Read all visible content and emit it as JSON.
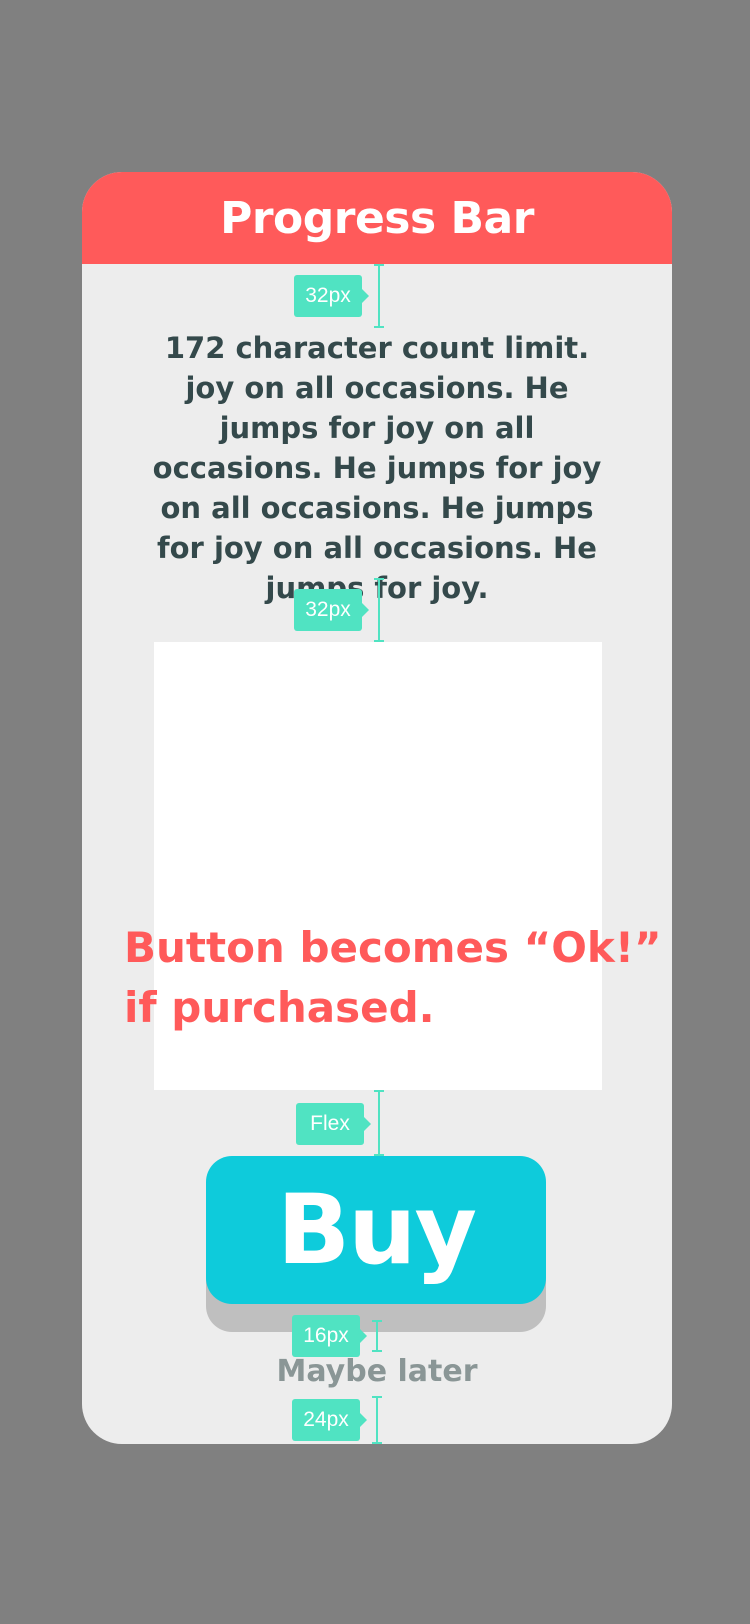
{
  "header": {
    "title": "Progress Bar"
  },
  "content": {
    "body_text": "172 character count limit. joy on all occasions. He jumps for joy on all occasions. He jumps for joy on all occasions. He jumps for joy on all occasions. He jumps for joy."
  },
  "annotation": {
    "note_line1": "Button becomes “Ok!”",
    "note_line2": "if purchased."
  },
  "actions": {
    "buy_label": "Buy",
    "maybe_later_label": "Maybe later"
  },
  "spacing_markers": {
    "header_to_text": "32px",
    "text_to_image": "32px",
    "image_to_button": "Flex",
    "button_to_link": "16px",
    "link_to_bottom": "24px"
  },
  "colors": {
    "background": "#808080",
    "card": "#ededed",
    "header": "#ff5a5a",
    "accent_note": "#ff5a5a",
    "buy_button": "#0ecbdb",
    "marker": "#50e3c2",
    "body_text": "#34494b",
    "secondary_text": "#8a9696"
  }
}
